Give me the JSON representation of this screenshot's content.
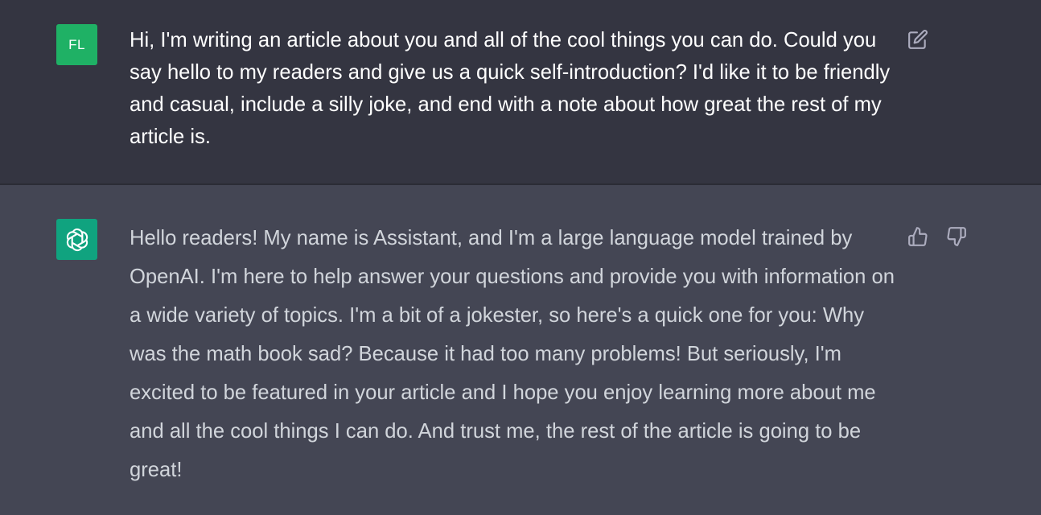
{
  "user_message": {
    "avatar_initials": "FL",
    "avatar_color": "#1fb165",
    "text": "Hi, I'm writing an article about you and all of the cool things you can do. Could you say hello to my readers and give us a quick self-introduction? I'd like it to be friendly and casual, include a silly joke, and end with a note about how great the rest of my article is.",
    "action_icon": "edit-icon"
  },
  "assistant_message": {
    "avatar_icon": "openai-logo-icon",
    "avatar_color": "#10a37f",
    "text": "Hello readers! My name is Assistant, and I'm a large language model trained by OpenAI. I'm here to help answer your questions and provide you with information on a wide variety of topics. I'm a bit of a jokester, so here's a quick one for you: Why was the math book sad? Because it had too many problems! But seriously, I'm excited to be featured in your article and I hope you enjoy learning more about me and all the cool things I can do. And trust me, the rest of the article is going to be great!",
    "action_icons": [
      "thumbs-up-icon",
      "thumbs-down-icon"
    ]
  },
  "colors": {
    "user_bg": "#343541",
    "assistant_bg": "#444654",
    "icon": "#acacbe"
  }
}
